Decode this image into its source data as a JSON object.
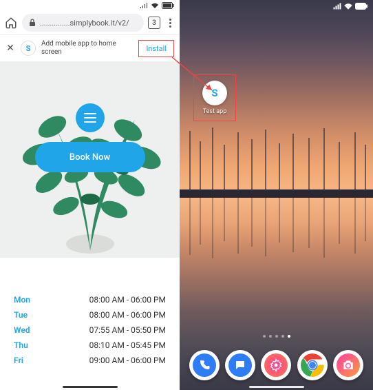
{
  "accent": "#1fa5e8",
  "browser": {
    "url": "...............simplybook.it/v2/",
    "tab_count": "3"
  },
  "install_banner": {
    "text": "Add mobile app to home screen",
    "button": "Install",
    "logo_letter": "S"
  },
  "hero": {
    "book_label": "Book Now"
  },
  "hours": [
    {
      "day": "Mon",
      "time": "08:00 AM - 06:00 PM"
    },
    {
      "day": "Tue",
      "time": "08:00 AM - 06:00 PM"
    },
    {
      "day": "Wed",
      "time": "07:55 AM - 05:50 PM"
    },
    {
      "day": "Thu",
      "time": "08:10 AM - 05:45 PM"
    },
    {
      "day": "Fri",
      "time": "09:00 AM - 06:00 PM"
    }
  ],
  "home_screen": {
    "app_label": "Test app",
    "app_logo_letter": "S",
    "dock": [
      "phone",
      "messages",
      "settings",
      "chrome",
      "camera"
    ],
    "active_page_index": 4,
    "page_count": 5
  }
}
